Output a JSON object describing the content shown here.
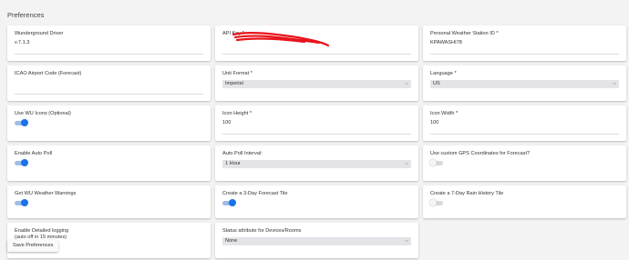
{
  "page": {
    "title": "Preferences"
  },
  "fields": {
    "driver": {
      "label": "Wunderground Driver",
      "value": "v.7.1.3"
    },
    "api_key": {
      "label": "API Key *",
      "value": ""
    },
    "station_id": {
      "label": "Personal Weather Station ID *",
      "value": "KPAWASHI78"
    },
    "icao": {
      "label": "ICAO Airport Code (Forecast)",
      "value": ""
    },
    "unit_format": {
      "label": "Unit Format *",
      "selected": "Imperial"
    },
    "language": {
      "label": "Language *",
      "selected": "US"
    },
    "use_wu_icons": {
      "label": "Use WU Icons (Optional)",
      "on": true
    },
    "icon_height": {
      "label": "Icon Height *",
      "value": "100"
    },
    "icon_width": {
      "label": "Icon Width *",
      "value": "100"
    },
    "auto_poll": {
      "label": "Enable Auto Poll",
      "on": true
    },
    "poll_interval": {
      "label": "Auto Poll Interval:",
      "selected": "1 Hour"
    },
    "custom_gps": {
      "label": "Use custom GPS Coordinates for Forecast?",
      "on": false
    },
    "wu_warnings": {
      "label": "Get WU Weather Warnings",
      "on": true
    },
    "forecast_tile": {
      "label": "Create a 3-Day Forecast Tile",
      "on": true
    },
    "rain_tile": {
      "label": "Create a 7-Day Rain History Tile",
      "on": false
    },
    "detailed_logging": {
      "label": "Enable Detailed logging\n(auto off in 15 minutes)",
      "on": false
    },
    "status_attribute": {
      "label": "Status attribute for Devices/Rooms",
      "selected": "None"
    }
  },
  "buttons": {
    "save": "Save Preferences"
  },
  "colors": {
    "toggle_on": "#1a73e8",
    "redaction": "#e8141b"
  }
}
